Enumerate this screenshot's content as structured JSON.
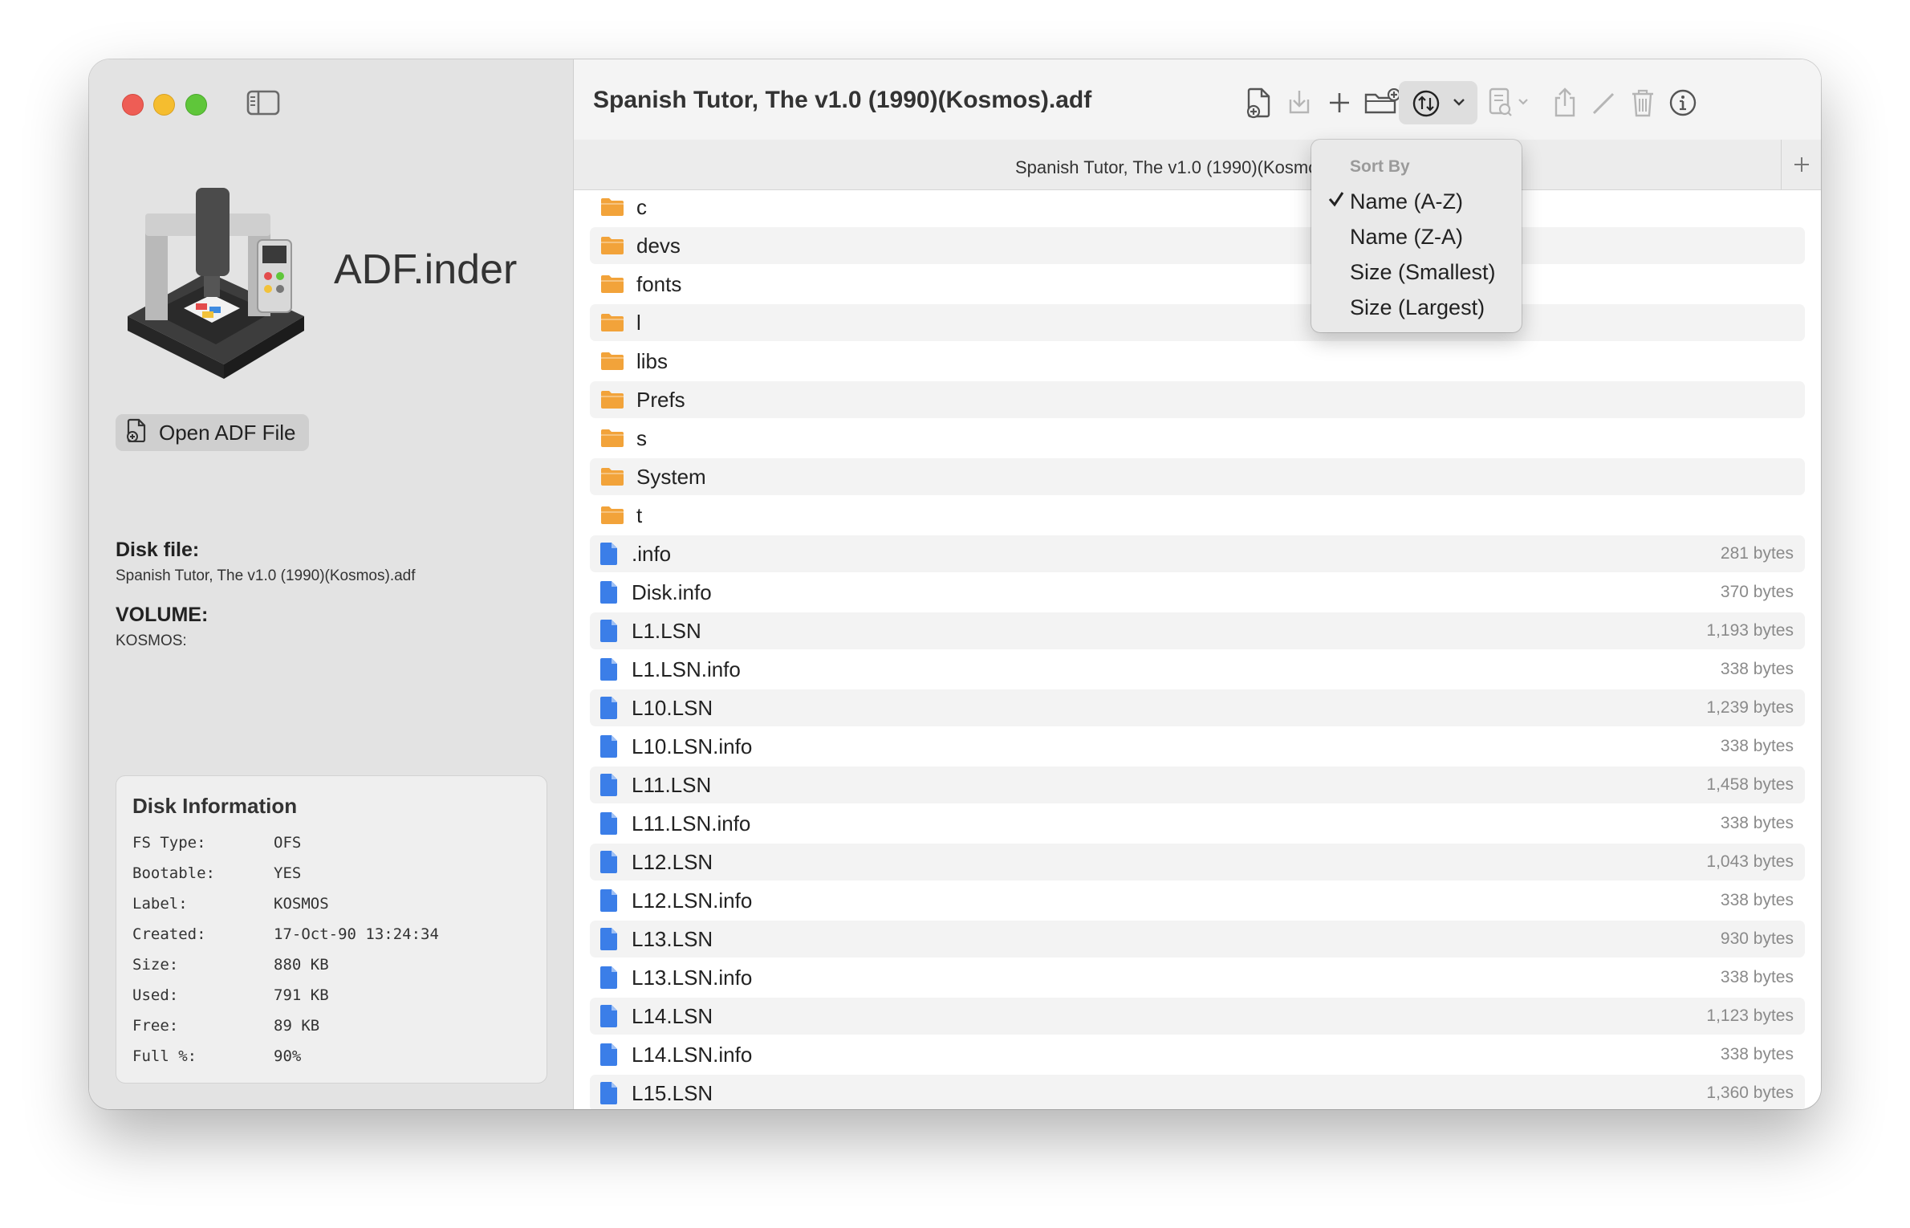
{
  "app": {
    "name": "ADF.inder"
  },
  "window": {
    "title": "Spanish Tutor, The v1.0 (1990)(Kosmos).adf",
    "tab_title": "Spanish Tutor, The v1.0 (1990)(Kosmos).adf"
  },
  "sidebar": {
    "open_button_label": "Open ADF File",
    "disk_file_heading": "Disk file:",
    "disk_file_value": "Spanish Tutor, The v1.0 (1990)(Kosmos).adf",
    "volume_heading": "VOLUME:",
    "volume_value": "KOSMOS:"
  },
  "disk_info": {
    "title": "Disk Information",
    "rows": [
      {
        "key": "FS Type:",
        "value": "OFS"
      },
      {
        "key": "Bootable:",
        "value": "YES"
      },
      {
        "key": "Label:",
        "value": "KOSMOS"
      },
      {
        "key": "Created:",
        "value": "17-Oct-90 13:24:34"
      },
      {
        "key": "Size:",
        "value": "880 KB"
      },
      {
        "key": "Used:",
        "value": "791 KB"
      },
      {
        "key": "Free:",
        "value": "89 KB"
      },
      {
        "key": "Full %:",
        "value": "90%"
      }
    ]
  },
  "toolbar": {
    "icons": [
      "new-file-icon",
      "extract-icon",
      "add-icon",
      "new-folder-icon",
      "sort-icon",
      "preview-icon",
      "share-icon",
      "rename-icon",
      "trash-icon",
      "info-icon"
    ]
  },
  "sort_menu": {
    "header": "Sort By",
    "items": [
      "Name (A-Z)",
      "Name (Z-A)",
      "Size (Smallest)",
      "Size (Largest)"
    ],
    "checked_index": 0
  },
  "files": [
    {
      "name": "c",
      "type": "folder",
      "size": ""
    },
    {
      "name": "devs",
      "type": "folder",
      "size": ""
    },
    {
      "name": "fonts",
      "type": "folder",
      "size": ""
    },
    {
      "name": "l",
      "type": "folder",
      "size": ""
    },
    {
      "name": "libs",
      "type": "folder",
      "size": ""
    },
    {
      "name": "Prefs",
      "type": "folder",
      "size": ""
    },
    {
      "name": "s",
      "type": "folder",
      "size": ""
    },
    {
      "name": "System",
      "type": "folder",
      "size": ""
    },
    {
      "name": "t",
      "type": "folder",
      "size": ""
    },
    {
      "name": ".info",
      "type": "file",
      "size": "281 bytes"
    },
    {
      "name": "Disk.info",
      "type": "file",
      "size": "370 bytes"
    },
    {
      "name": "L1.LSN",
      "type": "file",
      "size": "1,193 bytes"
    },
    {
      "name": "L1.LSN.info",
      "type": "file",
      "size": "338 bytes"
    },
    {
      "name": "L10.LSN",
      "type": "file",
      "size": "1,239 bytes"
    },
    {
      "name": "L10.LSN.info",
      "type": "file",
      "size": "338 bytes"
    },
    {
      "name": "L11.LSN",
      "type": "file",
      "size": "1,458 bytes"
    },
    {
      "name": "L11.LSN.info",
      "type": "file",
      "size": "338 bytes"
    },
    {
      "name": "L12.LSN",
      "type": "file",
      "size": "1,043 bytes"
    },
    {
      "name": "L12.LSN.info",
      "type": "file",
      "size": "338 bytes"
    },
    {
      "name": "L13.LSN",
      "type": "file",
      "size": "930 bytes"
    },
    {
      "name": "L13.LSN.info",
      "type": "file",
      "size": "338 bytes"
    },
    {
      "name": "L14.LSN",
      "type": "file",
      "size": "1,123 bytes"
    },
    {
      "name": "L14.LSN.info",
      "type": "file",
      "size": "338 bytes"
    },
    {
      "name": "L15.LSN",
      "type": "file",
      "size": "1,360 bytes"
    }
  ],
  "colors": {
    "folder": "#f2a33a",
    "file": "#3b7ee8",
    "close": "#ee5d55",
    "minimize": "#f5bd2f",
    "maximize": "#5fc63a"
  }
}
